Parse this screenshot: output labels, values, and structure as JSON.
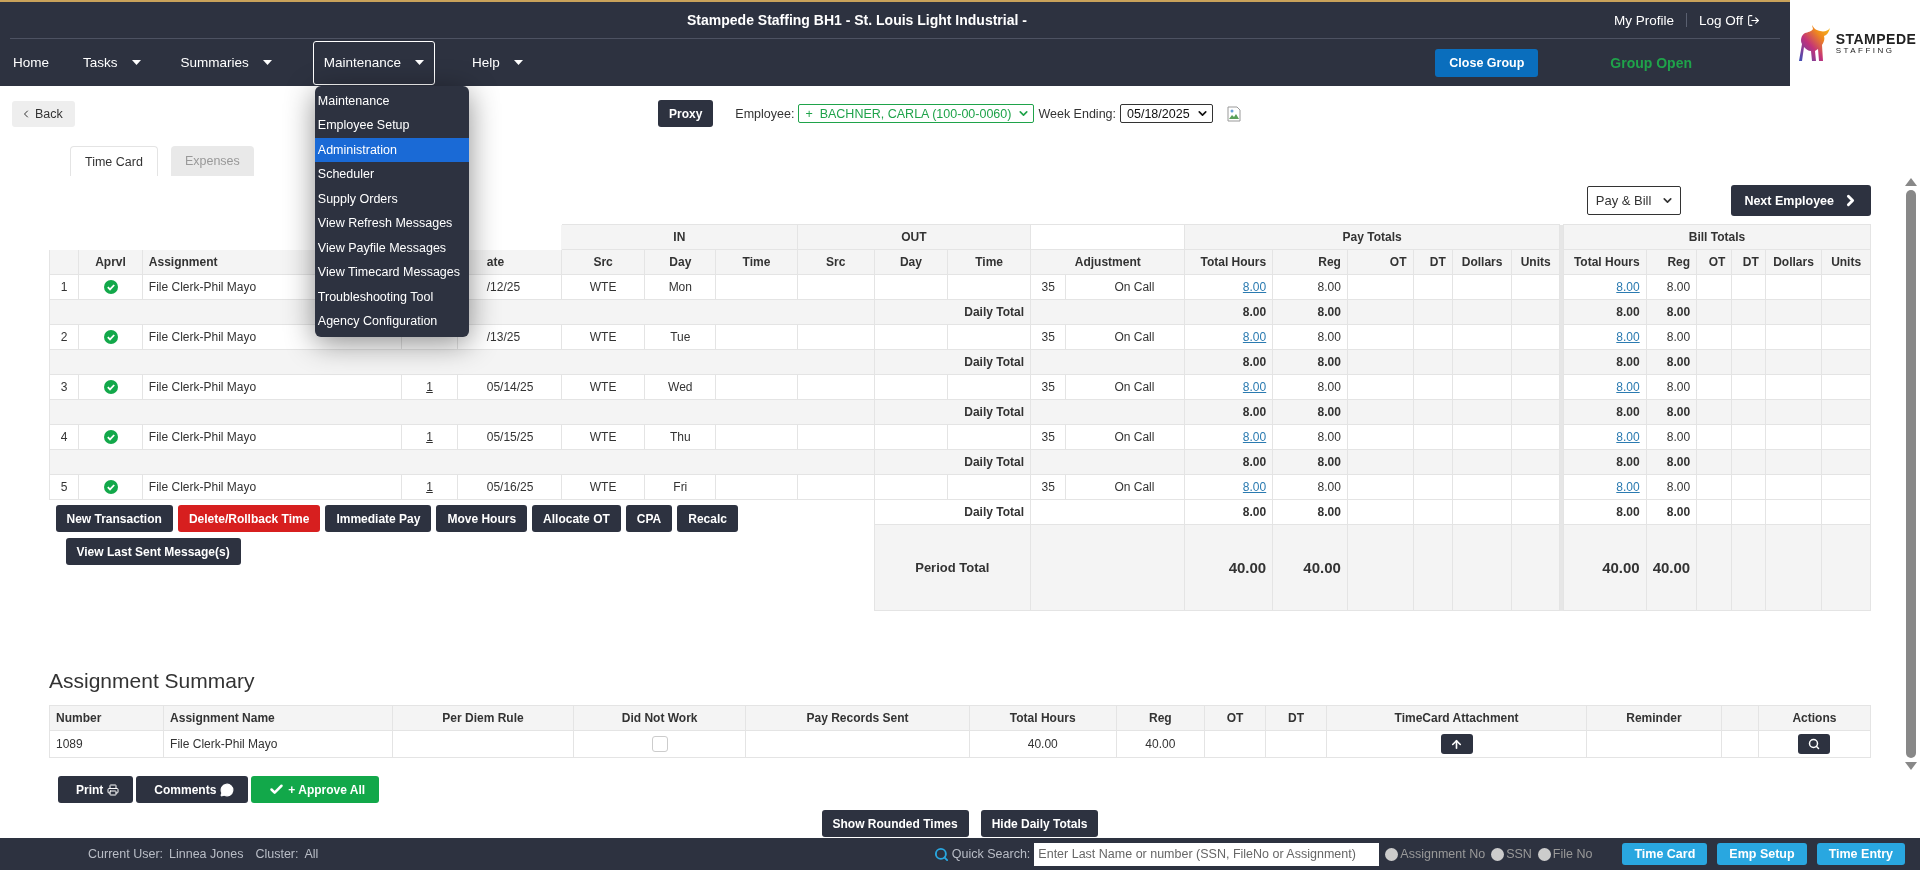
{
  "header": {
    "title": "Stampede Staffing BH1 - St. Louis Light Industrial -",
    "profile_link": "My Profile",
    "logoff_link": "Log Off",
    "close_group": "Close Group",
    "group_status": "Group Open",
    "logo": {
      "name": "STAMPEDE",
      "sub": "STAFFING"
    },
    "nav": [
      {
        "label": "Home",
        "has_menu": false,
        "expanded": false
      },
      {
        "label": "Tasks",
        "has_menu": true,
        "expanded": false
      },
      {
        "label": "Summaries",
        "has_menu": true,
        "expanded": false
      },
      {
        "label": "Maintenance",
        "has_menu": true,
        "expanded": true
      },
      {
        "label": "Help",
        "has_menu": true,
        "expanded": false
      }
    ]
  },
  "menu": {
    "items": [
      {
        "label": "Maintenance",
        "selected": false
      },
      {
        "label": "Employee Setup",
        "selected": false
      },
      {
        "label": "Administration",
        "selected": true
      },
      {
        "label": "Scheduler",
        "selected": false
      },
      {
        "label": "Supply Orders",
        "selected": false
      },
      {
        "label": "View Refresh Messages",
        "selected": false
      },
      {
        "label": "View Payfile Messages",
        "selected": false
      },
      {
        "label": "View Timecard Messages",
        "selected": false
      },
      {
        "label": "Troubleshooting Tool",
        "selected": false
      },
      {
        "label": "Agency Configuration",
        "selected": false
      }
    ]
  },
  "toolbar": {
    "back": "Back",
    "proxy": "Proxy",
    "employee_label": "Employee:",
    "employee_value": "+  BACHNER, CARLA (100-00-0060)",
    "week_label": "Week Ending:",
    "week_value": "05/18/2025"
  },
  "tabs": [
    {
      "label": "Time Card",
      "selected": true
    },
    {
      "label": "Expenses",
      "selected": false
    }
  ],
  "view_select": "Pay & Bill",
  "next_button": "Next Employee",
  "timecard": {
    "in_label": "IN",
    "out_label": "OUT",
    "pay_label": "Pay Totals",
    "bill_label": "Bill Totals",
    "columns_left": [
      "Aprvl",
      "Assignment"
    ],
    "date_column": "ate",
    "in_columns": [
      "Src",
      "Day",
      "Time"
    ],
    "out_columns": [
      "Src",
      "Day",
      "Time"
    ],
    "adjustment_column": "Adjustment",
    "pay_columns": [
      "Total Hours",
      "Reg",
      "OT",
      "DT",
      "Dollars",
      "Units"
    ],
    "bill_columns": [
      "Total Hours",
      "Reg",
      "OT",
      "DT",
      "Dollars",
      "Units"
    ],
    "rows": [
      {
        "num": "1",
        "approved": true,
        "assignment": "File Clerk-Phil Mayo",
        "date": "/12/25",
        "src": "WTE",
        "day": "Mon",
        "adj_code": "35",
        "adj_type": "On Call",
        "pay_total": "8.00",
        "pay_reg": "8.00",
        "bill_total": "8.00",
        "bill_reg": "8.00",
        "daily": {
          "label": "Daily Total",
          "pay_total": "8.00",
          "pay_reg": "8.00",
          "bill_total": "8.00",
          "bill_reg": "8.00"
        }
      },
      {
        "num": "2",
        "approved": true,
        "assignment": "File Clerk-Phil Mayo",
        "date": "/13/25",
        "src": "WTE",
        "day": "Tue",
        "adj_code": "35",
        "adj_type": "On Call",
        "pay_total": "8.00",
        "pay_reg": "8.00",
        "bill_total": "8.00",
        "bill_reg": "8.00",
        "daily": {
          "label": "Daily Total",
          "pay_total": "8.00",
          "pay_reg": "8.00",
          "bill_total": "8.00",
          "bill_reg": "8.00"
        }
      },
      {
        "num": "3",
        "approved": true,
        "assignment": "File Clerk-Phil Mayo",
        "link": "1",
        "date": "05/14/25",
        "src": "WTE",
        "day": "Wed",
        "adj_code": "35",
        "adj_type": "On Call",
        "pay_total": "8.00",
        "pay_reg": "8.00",
        "bill_total": "8.00",
        "bill_reg": "8.00",
        "daily": {
          "label": "Daily Total",
          "pay_total": "8.00",
          "pay_reg": "8.00",
          "bill_total": "8.00",
          "bill_reg": "8.00"
        }
      },
      {
        "num": "4",
        "approved": true,
        "assignment": "File Clerk-Phil Mayo",
        "link": "1",
        "date": "05/15/25",
        "src": "WTE",
        "day": "Thu",
        "adj_code": "35",
        "adj_type": "On Call",
        "pay_total": "8.00",
        "pay_reg": "8.00",
        "bill_total": "8.00",
        "bill_reg": "8.00",
        "daily": {
          "label": "Daily Total",
          "pay_total": "8.00",
          "pay_reg": "8.00",
          "bill_total": "8.00",
          "bill_reg": "8.00"
        }
      },
      {
        "num": "5",
        "approved": true,
        "assignment": "File Clerk-Phil Mayo",
        "link": "1",
        "date": "05/16/25",
        "src": "WTE",
        "day": "Fri",
        "adj_code": "35",
        "adj_type": "On Call",
        "pay_total": "8.00",
        "pay_reg": "8.00",
        "bill_total": "8.00",
        "bill_reg": "8.00",
        "daily": {
          "label": "Daily Total",
          "pay_total": "8.00",
          "pay_reg": "8.00",
          "bill_total": "8.00",
          "bill_reg": "8.00"
        }
      }
    ],
    "period": {
      "label": "Period Total",
      "pay_total": "40.00",
      "pay_reg": "40.00",
      "bill_total": "40.00",
      "bill_reg": "40.00"
    },
    "action_rows": [
      [
        {
          "label": "New Transaction",
          "kind": "default"
        },
        {
          "label": "Delete/Rollback Time",
          "kind": "danger"
        },
        {
          "label": "Immediate Pay",
          "kind": "default"
        },
        {
          "label": "Move Hours",
          "kind": "default"
        },
        {
          "label": "Allocate OT",
          "kind": "default"
        },
        {
          "label": "CPA",
          "kind": "default"
        },
        {
          "label": "Recalc",
          "kind": "default"
        }
      ],
      [
        {
          "label": "View Last Sent Message(s)",
          "kind": "default"
        }
      ]
    ]
  },
  "summary": {
    "title": "Assignment Summary",
    "columns": [
      "Number",
      "Assignment Name",
      "Per Diem Rule",
      "Did Not Work",
      "Pay Records Sent",
      "Total Hours",
      "Reg",
      "OT",
      "DT",
      "TimeCard Attachment",
      "Reminder",
      "Actions"
    ],
    "rows": [
      {
        "number": "1089",
        "assignment": "File Clerk-Phil Mayo",
        "did_not_work": false,
        "total_hours": "40.00",
        "reg": "40.00"
      }
    ]
  },
  "bottom_buttons": [
    {
      "label": "Print",
      "kind": "print"
    },
    {
      "label": "Comments",
      "kind": "comments"
    },
    {
      "label": "+ Approve All",
      "kind": "approve"
    }
  ],
  "view_buttons": [
    "Show Rounded Times",
    "Hide Daily Totals"
  ],
  "footer": {
    "user_label": "Current User:",
    "user": "Linnea Jones",
    "cluster_label": "Cluster:",
    "cluster": "All",
    "search_label": "Quick Search:",
    "search_placeholder": "Enter Last Name or number (SSN, FileNo or Assignment)",
    "search_modes": [
      {
        "label": "Assignment No",
        "selected": false
      },
      {
        "label": "SSN",
        "selected": false
      },
      {
        "label": "File No",
        "selected": false
      }
    ],
    "buttons": [
      "Time Card",
      "Emp Setup",
      "Time Entry"
    ]
  }
}
